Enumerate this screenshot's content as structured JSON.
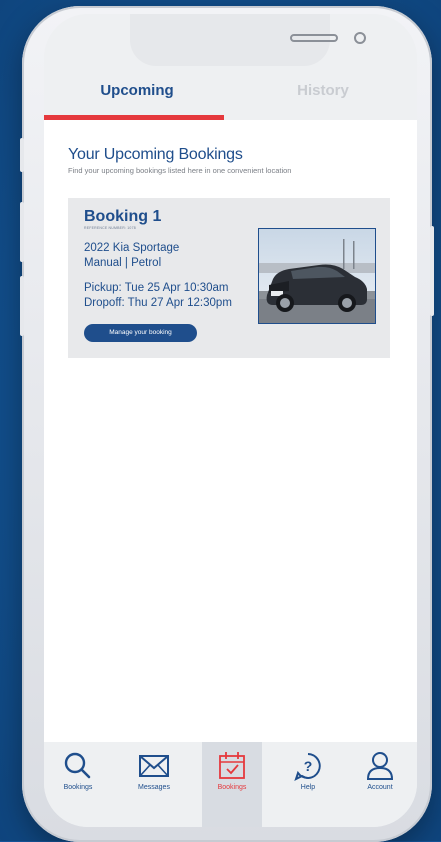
{
  "tabs": [
    {
      "label": "Upcoming",
      "active": true
    },
    {
      "label": "History",
      "active": false
    }
  ],
  "page": {
    "title": "Your Upcoming Bookings",
    "subtitle": "Find your upcoming bookings listed here in one convenient location"
  },
  "booking": {
    "title": "Booking 1",
    "reference": "REFERENCE NUMBER: 1078",
    "car": "2022 Kia Sportage",
    "spec": "Manual  |  Petrol",
    "pickup": "Pickup: Tue 25 Apr 10:30am",
    "dropoff": "Dropoff: Thu 27 Apr 12:30pm",
    "manage_label": "Manage your booking"
  },
  "nav": [
    {
      "label": "Bookings",
      "icon": "search-icon",
      "active": false
    },
    {
      "label": "Messages",
      "icon": "envelope-icon",
      "active": false
    },
    {
      "label": "Bookings",
      "icon": "calendar-check-icon",
      "active": true
    },
    {
      "label": "Help",
      "icon": "help-icon",
      "active": false
    },
    {
      "label": "Account",
      "icon": "user-icon",
      "active": false
    }
  ],
  "colors": {
    "brand": "#1f4e8c",
    "accent": "#e5393d",
    "background": "#14549a"
  }
}
